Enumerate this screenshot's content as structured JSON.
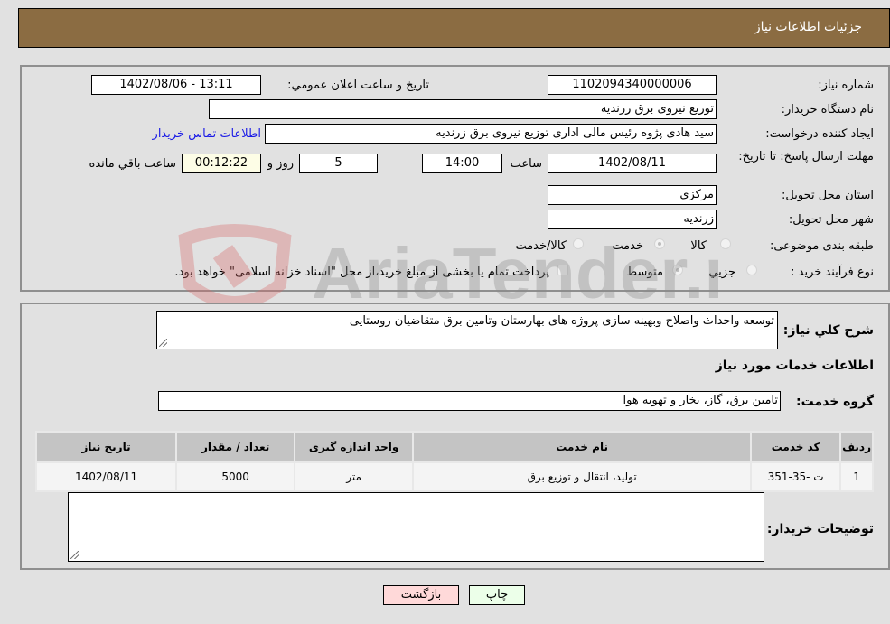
{
  "header": {
    "title": "جزئيات اطلاعات نياز"
  },
  "form": {
    "need_number": {
      "label": "شماره نیاز:",
      "value": "1102094340000006"
    },
    "announce_datetime": {
      "label": "تاريخ و ساعت اعلان عمومي:",
      "value": "1402/08/06 - 13:11"
    },
    "buyer_org": {
      "label": "نام دستگاه خریدار:",
      "value": "توزیع نیروی برق زرندیه"
    },
    "requester": {
      "label": "ایجاد کننده درخواست:",
      "value": "سید هادی  پژوه رئیس مالی اداری توزیع نیروی برق زرندیه"
    },
    "buyer_contact_link": "اطلاعات تماس خریدار",
    "deadline": {
      "label": "مهلت ارسال پاسخ: تا تاریخ:",
      "date": "1402/08/11",
      "time_label": "ساعت",
      "time": "14:00",
      "days": "5",
      "days_label": "روز و",
      "remaining": "00:12:22",
      "remaining_label": "ساعت باقي مانده"
    },
    "province": {
      "label": "استان محل تحویل:",
      "value": "مرکزی"
    },
    "city": {
      "label": "شهر محل تحویل:",
      "value": "زرندیه"
    },
    "category": {
      "label": "طبقه بندی موضوعی:",
      "options": [
        "کالا",
        "خدمت",
        "کالا/خدمت"
      ],
      "selected": "خدمت"
    },
    "purchase_process": {
      "label": "نوع فرآیند خرید :",
      "options": [
        "جزيي",
        "متوسط"
      ],
      "selected": "متوسط",
      "treasury_note": "پرداخت تمام يا بخشی از مبلغ خرید،از محل \"اسناد خزانه اسلامی\" خواهد بود."
    }
  },
  "details": {
    "general_desc_label": "شرح كلي نياز:",
    "general_desc": "توسعه واحداث واصلاح وبهینه سازی پروژه های بهارستان وتامین برق متقاضیان روستایی",
    "services_section_title": "اطلاعات خدمات مورد نیاز",
    "service_group_label": "گروه خدمت:",
    "service_group": "تامین برق، گاز، بخار و تهویه هوا",
    "table": {
      "headers": [
        "ردیف",
        "کد خدمت",
        "نام خدمت",
        "واحد اندازه گیری",
        "تعداد / مقدار",
        "تاریخ نیاز"
      ],
      "rows": [
        [
          "1",
          "ت -35-351",
          "تولید، انتقال و توزیع برق",
          "متر",
          "5000",
          "1402/08/11"
        ]
      ]
    },
    "buyer_notes_label": "توضیحات خریدار:",
    "buyer_notes": ""
  },
  "buttons": {
    "print": "چاپ",
    "back": "بازگشت"
  },
  "watermark": {
    "text": "AriaTender.net"
  }
}
